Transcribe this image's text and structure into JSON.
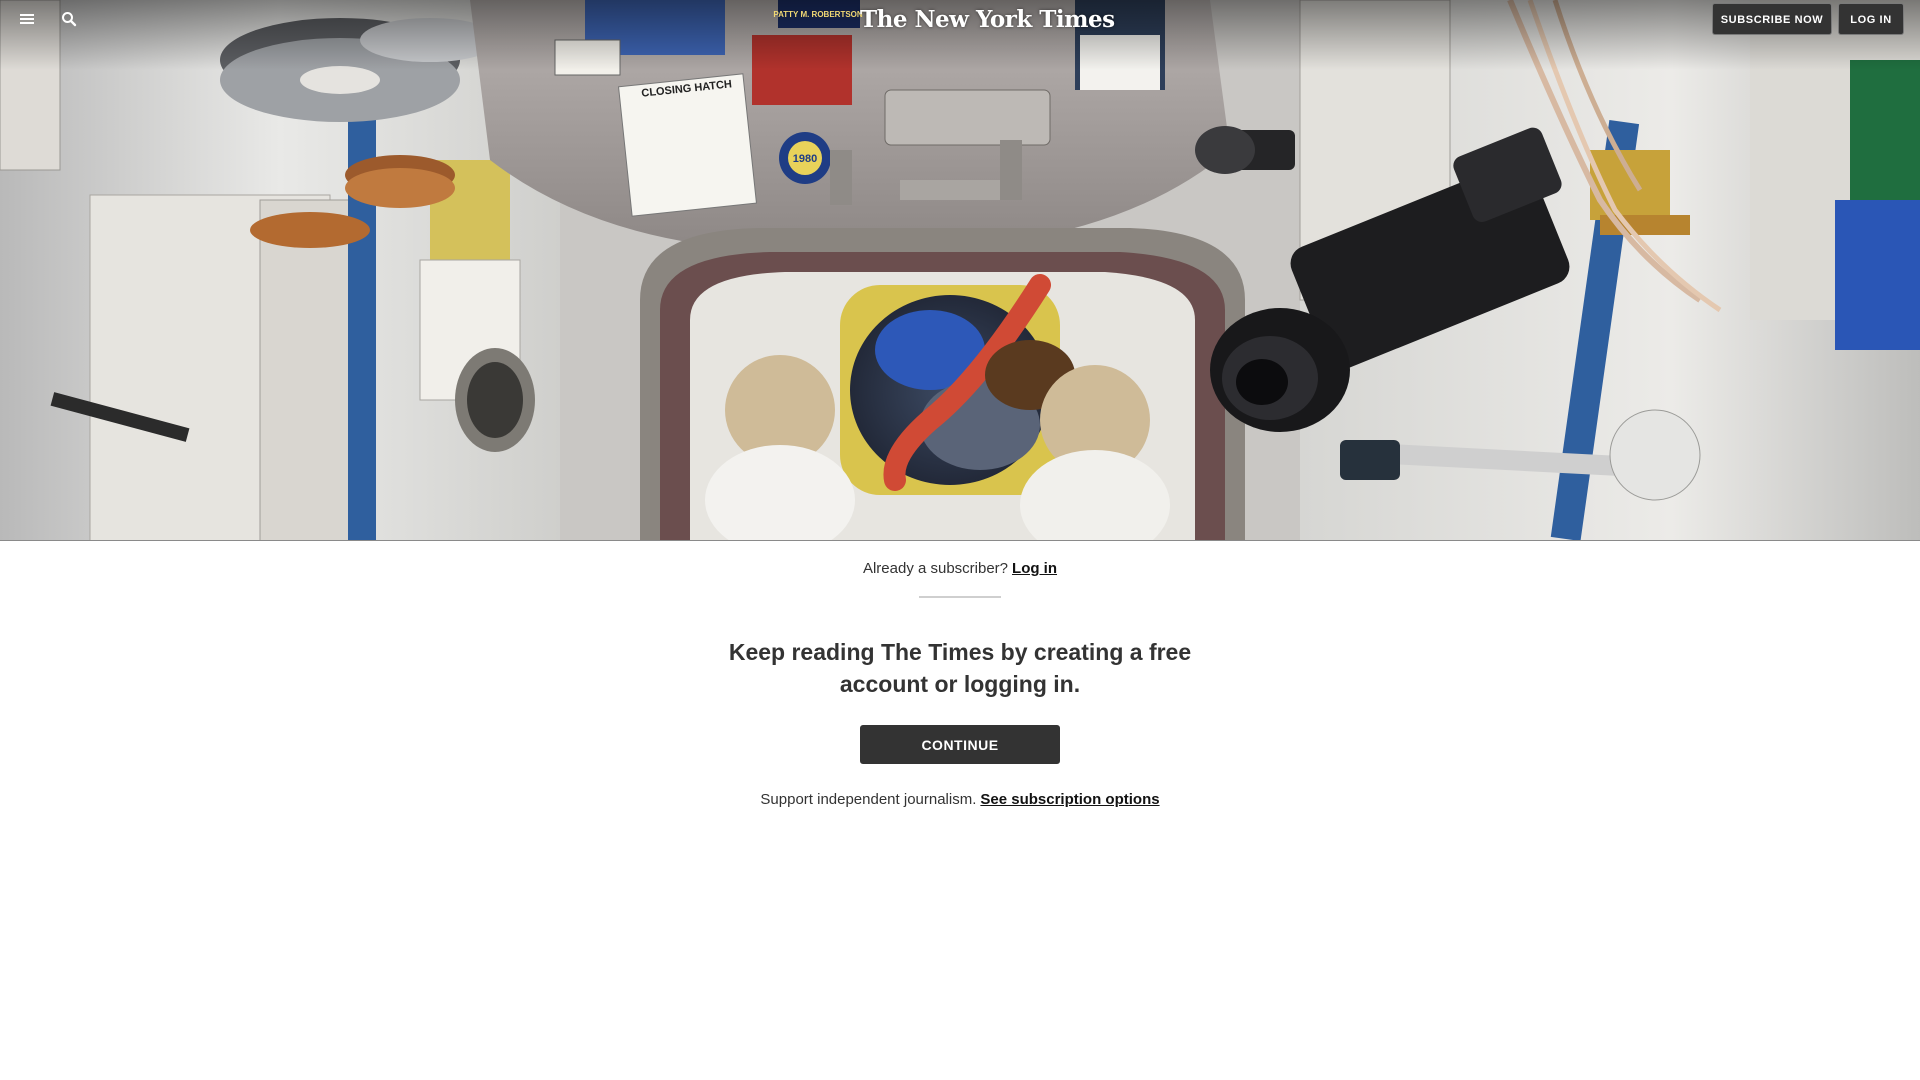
{
  "masthead": {
    "menu_icon": "hamburger-menu-icon",
    "search_icon": "search-icon",
    "logo_text": "The New York Times",
    "subscribe_label": "SUBSCRIBE NOW",
    "login_label": "LOG IN"
  },
  "hero": {
    "photo_text": {
      "closing_hatch": "CLOSING HATCH",
      "nameplate": "PATTY M. ROBERTSON",
      "patch": "1980"
    }
  },
  "gateway": {
    "already_text": "Already a subscriber?",
    "login_link": "Log in",
    "headline": "Keep reading The Times by creating a free account or logging in.",
    "continue_label": "CONTINUE",
    "support_text": "Support independent journalism.",
    "subscription_link": "See subscription options"
  },
  "colors": {
    "button_dark": "#333333",
    "text": "#121212",
    "divider": "#cfcfcf"
  }
}
